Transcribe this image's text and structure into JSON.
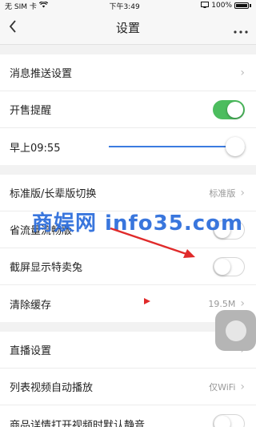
{
  "status_bar": {
    "carrier": "无 SIM 卡",
    "time": "下午3:49",
    "battery_text": "100%"
  },
  "nav": {
    "back_icon": "chevron-left-icon",
    "title": "设置",
    "more_icon": "ellipsis-icon"
  },
  "groups": [
    {
      "rows": [
        {
          "label": "消息推送设置",
          "type": "link"
        },
        {
          "label": "开售提醒",
          "type": "toggle",
          "on": true
        },
        {
          "label": "早上09:55",
          "type": "slider",
          "value_fraction": 1.0
        }
      ]
    },
    {
      "rows": [
        {
          "label": "标准版/长辈版切换",
          "type": "link",
          "value": "标准版"
        },
        {
          "label": "省流量流畅版",
          "type": "toggle",
          "on": false
        },
        {
          "label": "截屏显示特卖兔",
          "type": "toggle",
          "on": false
        },
        {
          "label": "清除缓存",
          "type": "link",
          "value": "19.5M"
        }
      ]
    },
    {
      "rows": [
        {
          "label": "直播设置",
          "type": "link"
        },
        {
          "label": "列表视频自动播放",
          "type": "link",
          "value": "仅WiFi"
        },
        {
          "label": "商品详情打开视频时默认静音",
          "type": "toggle",
          "on": false
        }
      ]
    }
  ],
  "watermark": "商娱网 info35.com",
  "colors": {
    "toggle_on": "#4cbd5e",
    "slider": "#3b7be0",
    "watermark": "#2f6fdc",
    "annotation_arrow": "#e02a2a"
  }
}
